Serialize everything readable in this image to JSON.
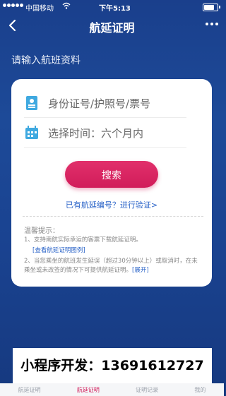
{
  "status": {
    "carrier": "中国移动",
    "time": "下午5:13"
  },
  "nav": {
    "title": "航延证明"
  },
  "section_label": "请输入航班资料",
  "form": {
    "id_placeholder": "身份证号/护照号/票号",
    "time_placeholder": "选择时间：六个月内",
    "search_label": "搜索",
    "verify_link": "已有航延编号？进行验证>"
  },
  "tips": {
    "title": "温馨提示：",
    "tip1": "1、支持南航实际承运的客票下载航延证明。",
    "tip1_link": "[查看航延证明图例]",
    "tip2": "2、当您乘坐的航班发生延误（超过30分钟以上）或取消时，在未乘坐或未改签的情况下可提供航延证明。",
    "tip2_expand": "[展开]"
  },
  "banner": {
    "text": "小程序开发：13691612727"
  },
  "tabs": [
    {
      "label": "航延证明"
    },
    {
      "label": "航延证明"
    },
    {
      "label": "证明记录"
    },
    {
      "label": "我的"
    }
  ],
  "colors": {
    "accent": "#d11c5a",
    "link": "#2b64c8",
    "background": "#1a3f8c"
  }
}
